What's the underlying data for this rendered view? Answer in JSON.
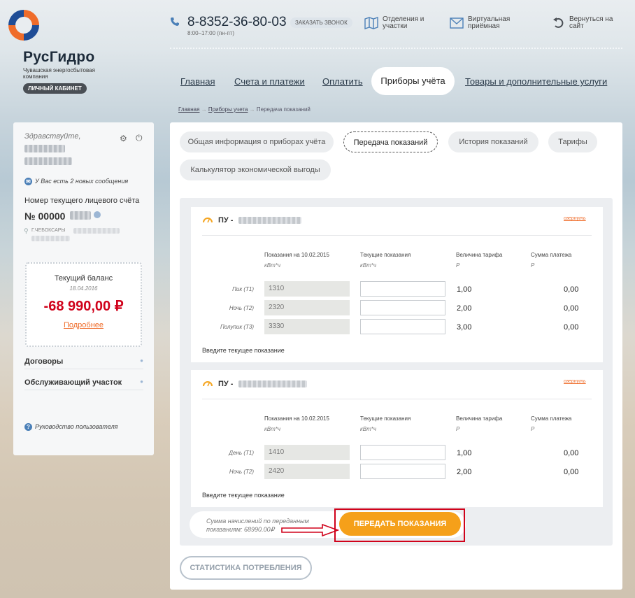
{
  "brand": {
    "name": "РусГидро",
    "subtitle": "Чувашская энергосбытовая компания",
    "badge": "ЛИЧНЫЙ КАБИНЕТ"
  },
  "header": {
    "phone": "8-8352-36-80-03",
    "hours": "8:00–17:00 (пн-пт)",
    "callback": "ЗАКАЗАТЬ ЗВОНОК",
    "links": [
      {
        "label": "Отделения и участки",
        "icon": "map-icon"
      },
      {
        "label": "Виртуальная приёмная",
        "icon": "mail-icon"
      },
      {
        "label": "Вернуться на сайт",
        "icon": "back-arrow-icon"
      }
    ]
  },
  "nav": {
    "items": [
      "Главная",
      "Счета и платежи",
      "Оплатить",
      "Приборы учёта",
      "Товары и дополнительные услуги"
    ],
    "active": "Приборы учёта"
  },
  "breadcrumb": [
    "Главная",
    "Приборы учета",
    "Передача показаний"
  ],
  "sidebar": {
    "greeting": "Здравствуйте,",
    "messages": "У Вас есть 2 новых сообщения",
    "account_label": "Номер текущего лицевого счёта",
    "account_number": "№ 00000",
    "address": "Г.ЧЕБОКСАРЫ",
    "balance_title": "Текущий баланс",
    "balance_date": "18.04.2016",
    "balance_amount": "-68 990,00 ₽",
    "balance_more": "Подробнее",
    "sections": [
      "Договоры",
      "Обслуживающий участок"
    ],
    "manual": "Руководство пользователя"
  },
  "tabs": [
    "Общая информация о приборах учёта",
    "Передача показаний",
    "История показаний",
    "Тарифы",
    "Калькулятор экономической выгоды"
  ],
  "active_tab": "Передача показаний",
  "columns": {
    "prev": "Показания на 10.02.2015",
    "prev_unit": "кВт*ч",
    "current": "Текущие показания",
    "current_unit": "кВт*ч",
    "tariff": "Величина тарифа",
    "tariff_unit": "Р",
    "sum": "Сумма платежа",
    "sum_unit": "Р"
  },
  "meters": [
    {
      "title": "ПУ -",
      "collapse": "свернуть",
      "rows": [
        {
          "label": "Пик (Т1)",
          "prev": "1310",
          "tariff": "1,00",
          "sum": "0,00"
        },
        {
          "label": "Ночь (Т2)",
          "prev": "2320",
          "tariff": "2,00",
          "sum": "0,00"
        },
        {
          "label": "Полупик (Т3)",
          "prev": "3330",
          "tariff": "3,00",
          "sum": "0,00"
        }
      ],
      "hint": "Введите текущее показание"
    },
    {
      "title": "ПУ -",
      "collapse": "свернуть",
      "rows": [
        {
          "label": "День (Т1)",
          "prev": "1410",
          "tariff": "1,00",
          "sum": "0,00"
        },
        {
          "label": "Ночь (Т2)",
          "prev": "2420",
          "tariff": "2,00",
          "sum": "0,00"
        }
      ],
      "hint": "Введите текущее показание"
    }
  ],
  "summary": {
    "line1": "Сумма начислений по переданным",
    "line2": "показаниям: 68990.00₽"
  },
  "submit": "ПЕРЕДАТЬ ПОКАЗАНИЯ",
  "stats": "СТАТИСТИКА ПОТРЕБЛЕНИЯ",
  "colors": {
    "accent": "#f5a01a",
    "brand_orange": "#ef6c2a",
    "link_blue": "#4a7fb7",
    "balance_red": "#d0021b"
  }
}
